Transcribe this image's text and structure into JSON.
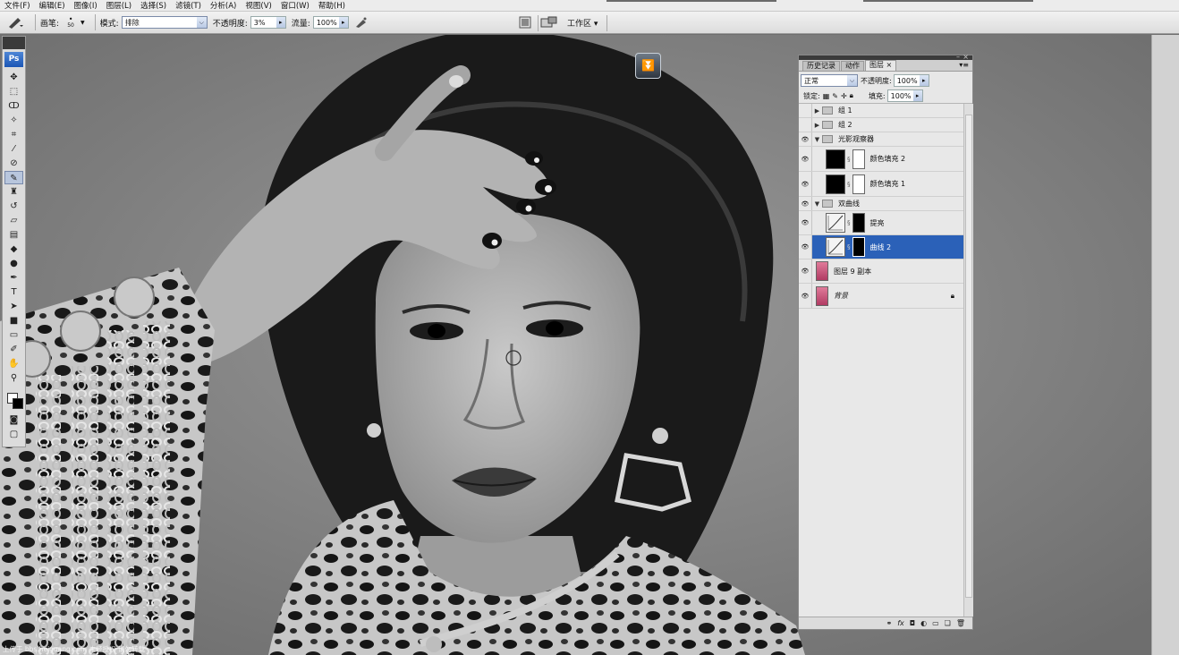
{
  "menu": {
    "items": [
      "文件(F)",
      "编辑(E)",
      "图像(I)",
      "图层(L)",
      "选择(S)",
      "滤镜(T)",
      "分析(A)",
      "视图(V)",
      "窗口(W)",
      "帮助(H)"
    ]
  },
  "options": {
    "brush_label": "画笔:",
    "brush_size": "50",
    "mode_label": "模式:",
    "mode_value": "排除",
    "opacity_label": "不透明度:",
    "opacity_value": "3%",
    "flow_label": "流量:",
    "flow_value": "100%",
    "workspace_label": "工作区 ▾"
  },
  "toolbox": {
    "logo": "Ps"
  },
  "canvas": {
    "watermark": "上传于 bbs.heiguang.com 未经授权 请勿转载"
  },
  "layers_panel": {
    "tabs": [
      "历史记录",
      "动作",
      "图层 ×"
    ],
    "active_tab": 2,
    "blend_mode": "正常",
    "opacity_label": "不透明度:",
    "opacity_value": "100%",
    "lock_label": "锁定:",
    "fill_label": "填充:",
    "fill_value": "100%",
    "layers": [
      {
        "name": "组 1",
        "kind": "group",
        "visible": false,
        "expanded": false
      },
      {
        "name": "组 2",
        "kind": "group",
        "visible": false,
        "expanded": false
      },
      {
        "name": "光影观察器",
        "kind": "group",
        "visible": true,
        "expanded": true
      },
      {
        "name": "颜色填充 2",
        "kind": "fill",
        "visible": true
      },
      {
        "name": "颜色填充 1",
        "kind": "fill",
        "visible": true
      },
      {
        "name": "双曲线",
        "kind": "group",
        "visible": true,
        "expanded": true
      },
      {
        "name": "提亮",
        "kind": "curves",
        "visible": true
      },
      {
        "name": "曲线 2",
        "kind": "curves",
        "visible": true,
        "selected": true
      },
      {
        "name": "图层 9 副本",
        "kind": "image",
        "visible": true
      },
      {
        "name": "背景",
        "kind": "image",
        "visible": true,
        "locked": true
      }
    ]
  },
  "colors": {
    "selection": "#2b61b8",
    "ps_blue": "#1b56b5"
  }
}
